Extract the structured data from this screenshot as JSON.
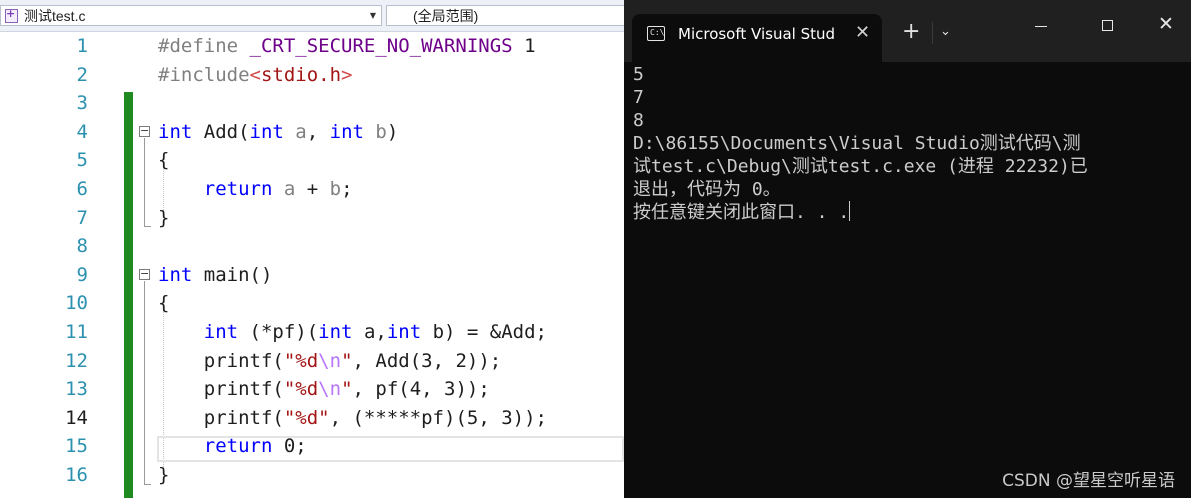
{
  "navbar": {
    "file_combo": "测试test.c",
    "scope_combo": "(全局范围)"
  },
  "editor": {
    "current_line": 14,
    "lines": [
      {
        "n": "1",
        "tokens": [
          {
            "t": "#define ",
            "c": "pp"
          },
          {
            "t": "_CRT_SECURE_NO_WARNINGS",
            "c": "mac"
          },
          {
            "t": " 1",
            "c": "num"
          }
        ]
      },
      {
        "n": "2",
        "tokens": [
          {
            "t": "#include",
            "c": "pp"
          },
          {
            "t": "<",
            "c": "ang"
          },
          {
            "t": "stdio.h",
            "c": "incl"
          },
          {
            "t": ">",
            "c": "ang"
          }
        ]
      },
      {
        "n": "3",
        "tokens": []
      },
      {
        "n": "4",
        "tokens": [
          {
            "t": "int",
            "c": "kw"
          },
          {
            "t": " Add(",
            "c": "id"
          },
          {
            "t": "int",
            "c": "kw"
          },
          {
            "t": " a",
            "c": "param"
          },
          {
            "t": ", ",
            "c": "id"
          },
          {
            "t": "int",
            "c": "kw"
          },
          {
            "t": " b",
            "c": "param"
          },
          {
            "t": ")",
            "c": "id"
          }
        ]
      },
      {
        "n": "5",
        "tokens": [
          {
            "t": "{",
            "c": "id"
          }
        ]
      },
      {
        "n": "6",
        "tokens": [
          {
            "t": "    ",
            "c": "id"
          },
          {
            "t": "return",
            "c": "kw"
          },
          {
            "t": " a",
            "c": "param"
          },
          {
            "t": " + ",
            "c": "id"
          },
          {
            "t": "b",
            "c": "param"
          },
          {
            "t": ";",
            "c": "id"
          }
        ]
      },
      {
        "n": "7",
        "tokens": [
          {
            "t": "}",
            "c": "id"
          }
        ]
      },
      {
        "n": "8",
        "tokens": []
      },
      {
        "n": "9",
        "tokens": [
          {
            "t": "int",
            "c": "kw"
          },
          {
            "t": " main()",
            "c": "id"
          }
        ]
      },
      {
        "n": "10",
        "tokens": [
          {
            "t": "{",
            "c": "id"
          }
        ]
      },
      {
        "n": "11",
        "tokens": [
          {
            "t": "    ",
            "c": "id"
          },
          {
            "t": "int",
            "c": "kw"
          },
          {
            "t": " (*pf)(",
            "c": "id"
          },
          {
            "t": "int",
            "c": "kw"
          },
          {
            "t": " a,",
            "c": "id"
          },
          {
            "t": "int",
            "c": "kw"
          },
          {
            "t": " b) = &Add;",
            "c": "id"
          }
        ]
      },
      {
        "n": "12",
        "tokens": [
          {
            "t": "    printf(",
            "c": "id"
          },
          {
            "t": "\"%d",
            "c": "str"
          },
          {
            "t": "\\n",
            "c": "esc"
          },
          {
            "t": "\"",
            "c": "str"
          },
          {
            "t": ", Add(3, 2));",
            "c": "id"
          }
        ]
      },
      {
        "n": "13",
        "tokens": [
          {
            "t": "    printf(",
            "c": "id"
          },
          {
            "t": "\"%d",
            "c": "str"
          },
          {
            "t": "\\n",
            "c": "esc"
          },
          {
            "t": "\"",
            "c": "str"
          },
          {
            "t": ", pf(4, 3));",
            "c": "id"
          }
        ]
      },
      {
        "n": "14",
        "tokens": [
          {
            "t": "    printf(",
            "c": "id"
          },
          {
            "t": "\"%d\"",
            "c": "str"
          },
          {
            "t": ", (*****pf)(5, 3));",
            "c": "id"
          }
        ]
      },
      {
        "n": "15",
        "tokens": [
          {
            "t": "    ",
            "c": "id"
          },
          {
            "t": "return",
            "c": "kw"
          },
          {
            "t": " 0;",
            "c": "id"
          }
        ]
      },
      {
        "n": "16",
        "tokens": [
          {
            "t": "}",
            "c": "id"
          }
        ]
      }
    ]
  },
  "console": {
    "tab_title": "Microsoft Visual Studio",
    "tab_close": "✕",
    "new_tab": "+",
    "tab_menu": "⌄",
    "output_lines": [
      "5",
      "7",
      "8",
      "D:\\86155\\Documents\\Visual Studio测试代码\\测",
      "试test.c\\Debug\\测试test.c.exe (进程 22232)已",
      "退出，代码为 0。",
      "按任意键关闭此窗口. . ."
    ]
  },
  "watermark": "CSDN @望星空听星语",
  "colors": {
    "keyword": "#0000ff",
    "macro": "#6f008a",
    "string": "#a31515",
    "escape": "#b776fb",
    "line_number": "#2b91af",
    "change_bar": "#1f8a1f",
    "console_bg": "#0c0c0c",
    "console_text": "#cccccc"
  }
}
